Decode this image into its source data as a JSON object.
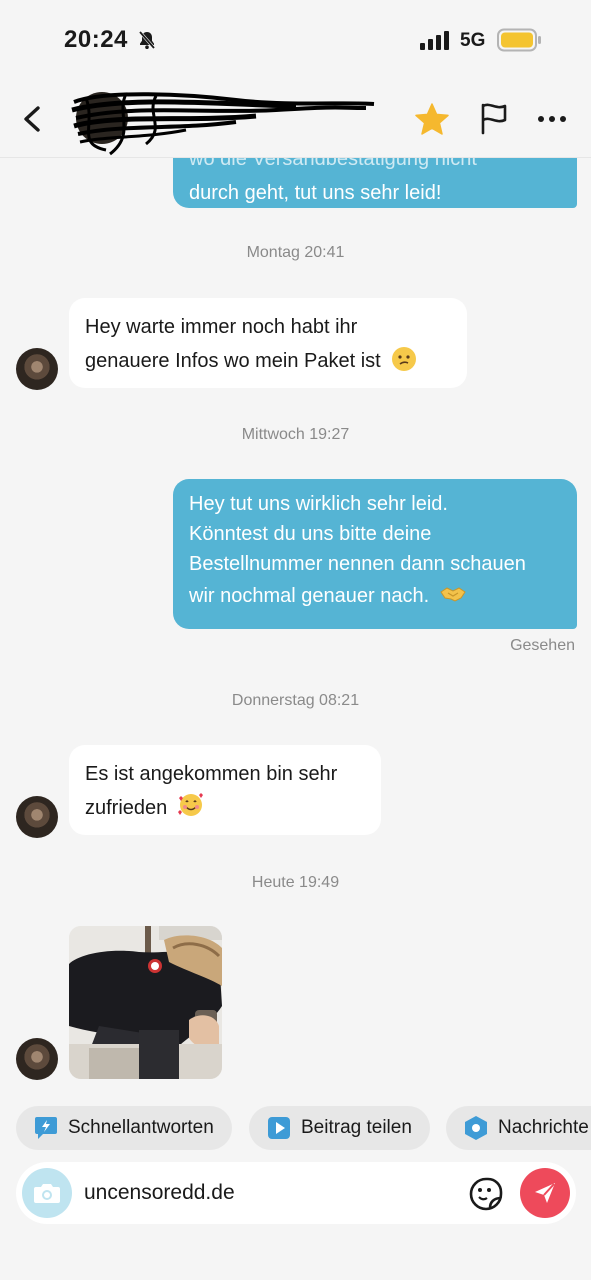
{
  "status_bar": {
    "time": "20:24",
    "network": "5G"
  },
  "header": {
    "back_icon": "chevron-left-icon",
    "contact_name_redacted": true,
    "favorite_icon": "star-icon",
    "favorite_color": "#f5b82e",
    "report_icon": "flag-icon",
    "more_icon": "ellipsis-icon"
  },
  "messages": [
    {
      "side": "out",
      "text_line1": "wo die Versandbestätigung nicht",
      "text_line2": "durch geht, tut uns sehr leid!"
    },
    {
      "timestamp": "Montag 20:41"
    },
    {
      "side": "in",
      "text_line1": "Hey warte immer noch habt ihr",
      "text_line2": "genauere Infos wo mein Paket ist",
      "emoji": "🙁"
    },
    {
      "timestamp": "Mittwoch 19:27"
    },
    {
      "side": "out",
      "text_line1": "Hey tut uns wirklich sehr leid.",
      "text_line2": "Könntest du uns bitte deine",
      "text_line3": "Bestellnummer nennen dann schauen",
      "text_line4": "wir nochmal genauer nach.",
      "emoji": "🤝",
      "status": "Gesehen"
    },
    {
      "timestamp": "Donnerstag 08:21"
    },
    {
      "side": "in",
      "text_line1": "Es ist angekommen bin sehr",
      "text_line2": "zufrieden",
      "emoji": "🥰"
    },
    {
      "timestamp": "Heute 19:49"
    },
    {
      "side": "in",
      "type": "photo"
    }
  ],
  "quick_actions": [
    {
      "label": "Schnellantworten",
      "icon": "quick-reply-icon"
    },
    {
      "label": "Beitrag teilen",
      "icon": "share-post-icon"
    },
    {
      "label": "Nachrichte",
      "icon": "hexagon-icon"
    }
  ],
  "composer": {
    "value": "uncensoredd.de",
    "camera_icon": "camera-icon",
    "sticker_icon": "sticker-icon",
    "send_icon": "send-icon",
    "accent": "#ee4a5b",
    "bubble_color": "#55b4d4"
  }
}
